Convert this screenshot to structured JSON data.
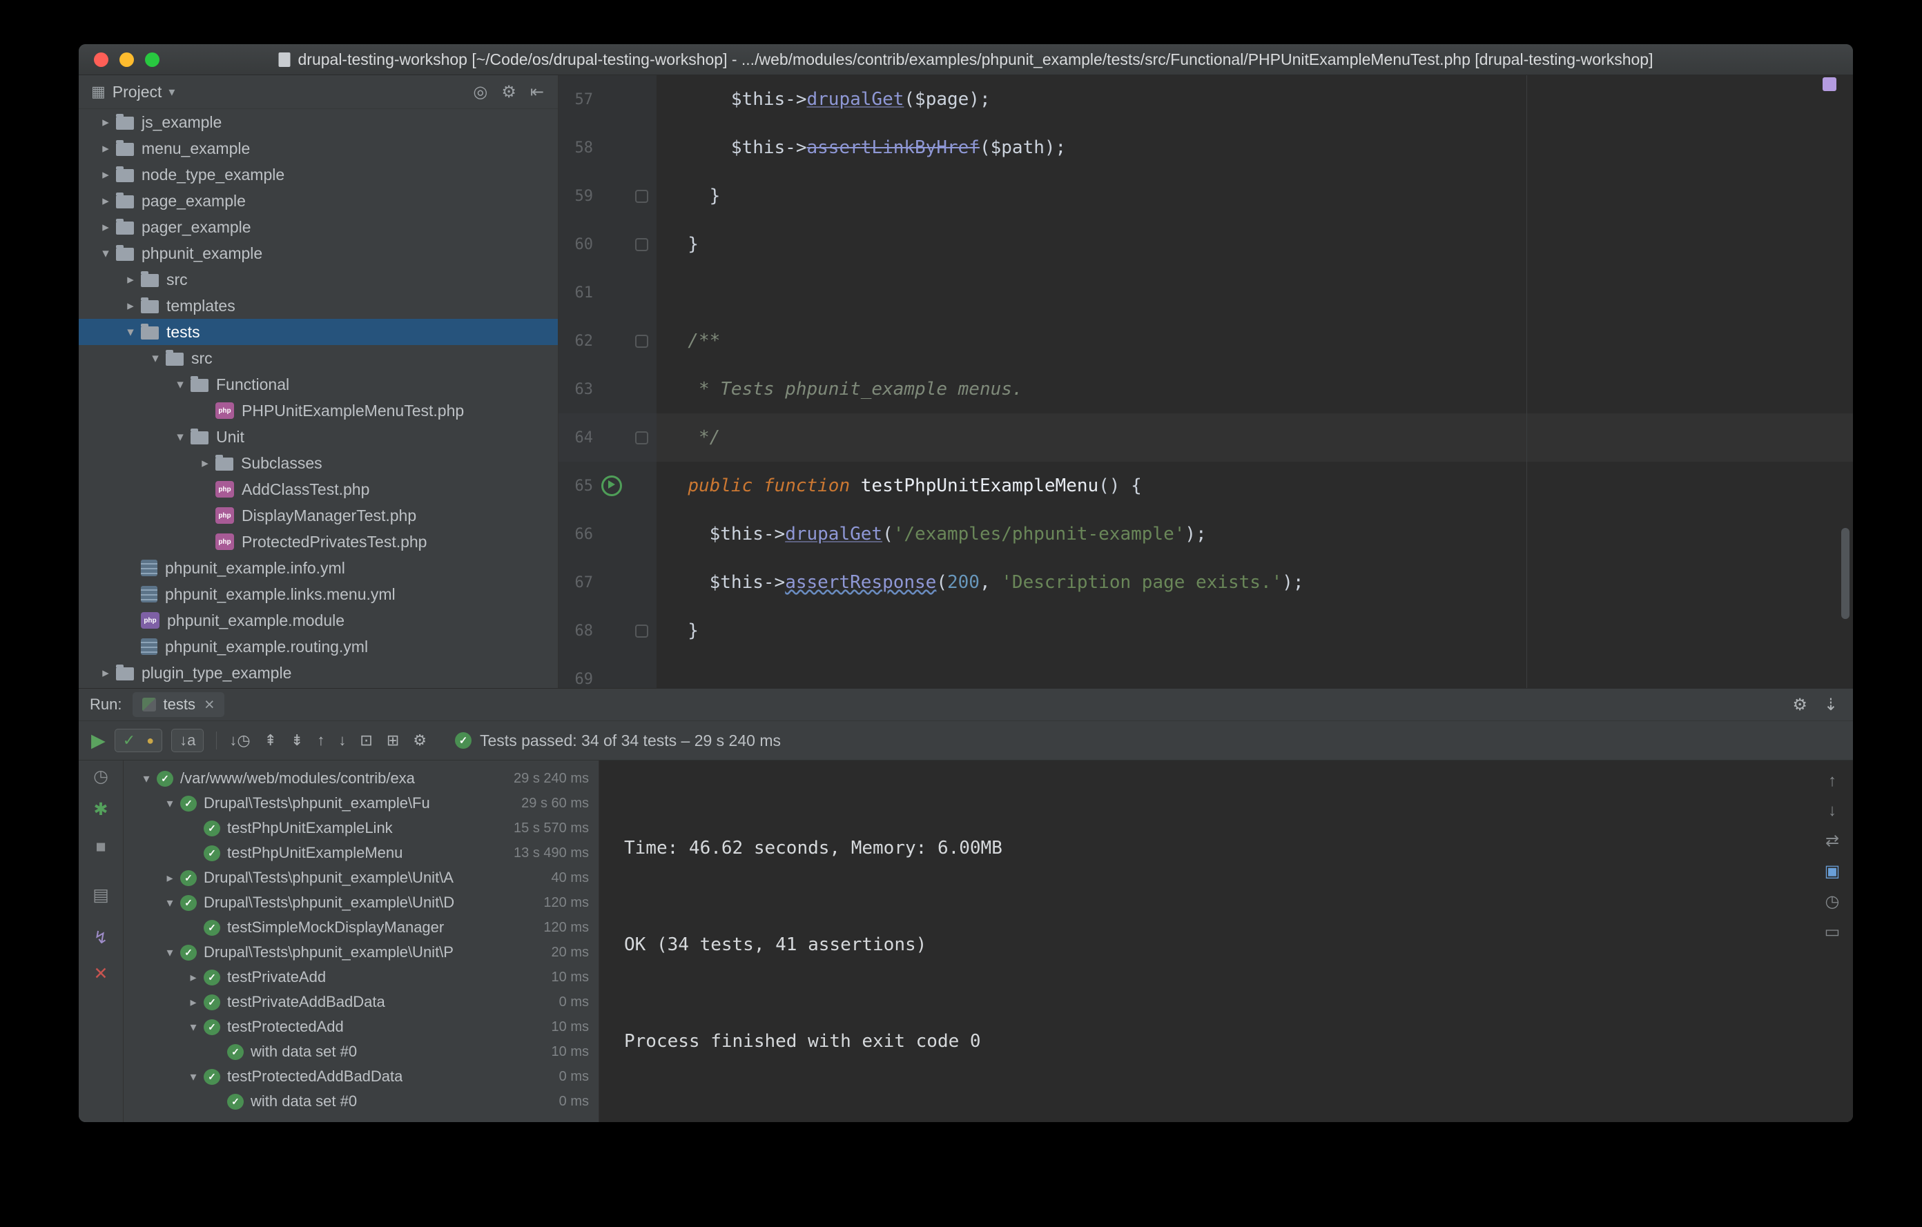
{
  "icons": {
    "expanded": "▾",
    "collapsed": "▸",
    "check": "✓",
    "close": "×",
    "php_badge": "php",
    "chevron": "▾",
    "project_tool": "▦"
  },
  "window": {
    "title": "drupal-testing-workshop [~/Code/os/drupal-testing-workshop] - .../web/modules/contrib/examples/phpunit_example/tests/src/Functional/PHPUnitExampleMenuTest.php [drupal-testing-workshop]"
  },
  "colors": {
    "selection_blue": "#26537C",
    "accent_green": "#499C54",
    "keyword_orange": "#CC7832",
    "string_green": "#6A8759",
    "number_blue": "#6897BB",
    "method_violet": "#8F98D6"
  },
  "project_panel": {
    "title": "Project",
    "actions": [
      {
        "name": "locate-file-icon",
        "glyph": "◎"
      },
      {
        "name": "settings-icon",
        "glyph": "⚙"
      },
      {
        "name": "hide-panel-icon",
        "glyph": "⇤"
      }
    ],
    "tree": [
      {
        "label": "js_example",
        "indent": 0,
        "arrow": "collapsed",
        "icon": "folder"
      },
      {
        "label": "menu_example",
        "indent": 0,
        "arrow": "collapsed",
        "icon": "folder"
      },
      {
        "label": "node_type_example",
        "indent": 0,
        "arrow": "collapsed",
        "icon": "folder"
      },
      {
        "label": "page_example",
        "indent": 0,
        "arrow": "collapsed",
        "icon": "folder"
      },
      {
        "label": "pager_example",
        "indent": 0,
        "arrow": "collapsed",
        "icon": "folder"
      },
      {
        "label": "phpunit_example",
        "indent": 0,
        "arrow": "expanded",
        "icon": "folder"
      },
      {
        "label": "src",
        "indent": 1,
        "arrow": "collapsed",
        "icon": "folder"
      },
      {
        "label": "templates",
        "indent": 1,
        "arrow": "collapsed",
        "icon": "folder"
      },
      {
        "label": "tests",
        "indent": 1,
        "arrow": "expanded",
        "icon": "folder",
        "selected": true
      },
      {
        "label": "src",
        "indent": 2,
        "arrow": "expanded",
        "icon": "folder"
      },
      {
        "label": "Functional",
        "indent": 3,
        "arrow": "expanded",
        "icon": "folder"
      },
      {
        "label": "PHPUnitExampleMenuTest.php",
        "indent": 4,
        "arrow": null,
        "icon": "php"
      },
      {
        "label": "Unit",
        "indent": 3,
        "arrow": "expanded",
        "icon": "folder"
      },
      {
        "label": "Subclasses",
        "indent": 4,
        "arrow": "collapsed",
        "icon": "folder"
      },
      {
        "label": "AddClassTest.php",
        "indent": 4,
        "arrow": null,
        "icon": "php"
      },
      {
        "label": "DisplayManagerTest.php",
        "indent": 4,
        "arrow": null,
        "icon": "php"
      },
      {
        "label": "ProtectedPrivatesTest.php",
        "indent": 4,
        "arrow": null,
        "icon": "php"
      },
      {
        "label": "phpunit_example.info.yml",
        "indent": 1,
        "arrow": null,
        "icon": "yml"
      },
      {
        "label": "phpunit_example.links.menu.yml",
        "indent": 1,
        "arrow": null,
        "icon": "yml"
      },
      {
        "label": "phpunit_example.module",
        "indent": 1,
        "arrow": null,
        "icon": "module"
      },
      {
        "label": "phpunit_example.routing.yml",
        "indent": 1,
        "arrow": null,
        "icon": "yml"
      },
      {
        "label": "plugin_type_example",
        "indent": 0,
        "arrow": "collapsed",
        "icon": "folder"
      }
    ]
  },
  "editor": {
    "lines": [
      {
        "num": "57",
        "gutter": "",
        "segments": [
          {
            "t": "      $this->",
            "s": "p"
          },
          {
            "t": "drupalGet",
            "s": "m"
          },
          {
            "t": "($page);",
            "s": "p"
          }
        ]
      },
      {
        "num": "58",
        "gutter": "",
        "segments": [
          {
            "t": "      $this->",
            "s": "p"
          },
          {
            "t": "assertLinkByHref",
            "s": "ms"
          },
          {
            "t": "($path);",
            "s": "p"
          }
        ]
      },
      {
        "num": "59",
        "gutter": "fold",
        "segments": [
          {
            "t": "    }",
            "s": "p"
          }
        ]
      },
      {
        "num": "60",
        "gutter": "fold",
        "segments": [
          {
            "t": "  }",
            "s": "p"
          }
        ]
      },
      {
        "num": "61",
        "gutter": "",
        "segments": []
      },
      {
        "num": "62",
        "gutter": "fold",
        "segments": [
          {
            "t": "  /**",
            "s": "c"
          }
        ]
      },
      {
        "num": "63",
        "gutter": "",
        "segments": [
          {
            "t": "   * Tests phpunit_example menus.",
            "s": "c"
          }
        ]
      },
      {
        "num": "64",
        "gutter": "fold",
        "caret": true,
        "segments": [
          {
            "t": "   */",
            "s": "c"
          }
        ]
      },
      {
        "num": "65",
        "gutter": "run",
        "segments": [
          {
            "t": "  ",
            "s": "p"
          },
          {
            "t": "public function",
            "s": "k"
          },
          {
            "t": " ",
            "s": "p"
          },
          {
            "t": "testPhpUnitExampleMenu",
            "s": "f"
          },
          {
            "t": "() {",
            "s": "p"
          }
        ]
      },
      {
        "num": "66",
        "gutter": "",
        "segments": [
          {
            "t": "    $this->",
            "s": "p"
          },
          {
            "t": "drupalGet",
            "s": "m"
          },
          {
            "t": "(",
            "s": "p"
          },
          {
            "t": "'/examples/phpunit-example'",
            "s": "str"
          },
          {
            "t": ");",
            "s": "p"
          }
        ]
      },
      {
        "num": "67",
        "gutter": "",
        "segments": [
          {
            "t": "    $this->",
            "s": "p"
          },
          {
            "t": "assertResponse",
            "s": "mw"
          },
          {
            "t": "(",
            "s": "p"
          },
          {
            "t": "200",
            "s": "n"
          },
          {
            "t": ", ",
            "s": "p"
          },
          {
            "t": "'Description page exists.'",
            "s": "str"
          },
          {
            "t": ");",
            "s": "p"
          }
        ]
      },
      {
        "num": "68",
        "gutter": "fold",
        "segments": [
          {
            "t": "  }",
            "s": "p"
          }
        ]
      },
      {
        "num": "69",
        "gutter": "",
        "segments": []
      }
    ]
  },
  "run_panel": {
    "label": "Run:",
    "tab": "tests",
    "tab_actions": [
      {
        "name": "settings-icon",
        "glyph": "⚙"
      },
      {
        "name": "hide-panel-icon",
        "glyph": "⇣"
      }
    ],
    "toolbar": {
      "rerun": {
        "name": "rerun-tests-icon",
        "glyph": "▶"
      },
      "filters": [
        {
          "name": "show-passed-icon",
          "glyph": "✓",
          "color": "green"
        },
        {
          "name": "show-ignored-icon",
          "glyph": "●",
          "color": "yellow"
        }
      ],
      "sort": [
        {
          "name": "sort-alphabetically-icon",
          "glyph": "↓a"
        }
      ],
      "icons": [
        {
          "name": "sort-by-duration-icon",
          "glyph": "↓◷"
        },
        {
          "name": "collapse-all-icon",
          "glyph": "⇞"
        },
        {
          "name": "expand-all-icon",
          "glyph": "⇟"
        },
        {
          "name": "previous-failed-test-icon",
          "glyph": "↑"
        },
        {
          "name": "next-failed-test-icon",
          "glyph": "↓"
        },
        {
          "name": "import-test-results-icon",
          "glyph": "⊡"
        },
        {
          "name": "export-test-results-icon",
          "glyph": "⊞"
        },
        {
          "name": "test-settings-icon",
          "glyph": "⚙"
        }
      ]
    },
    "status": {
      "text": "Tests passed: 34 of 34 tests – 29 s 240 ms"
    },
    "left_strip": [
      {
        "name": "test-history-icon",
        "glyph": "◷"
      },
      {
        "name": "rerun-failed-tests-icon",
        "glyph": "✱",
        "color": "green"
      },
      {
        "name": "stop-icon",
        "glyph": "■"
      },
      {
        "name": "console-view-icon",
        "glyph": "▤"
      },
      {
        "name": "plug-icon",
        "glyph": "↯",
        "color": "violet"
      },
      {
        "name": "close-icon",
        "glyph": "✕",
        "color": "red"
      }
    ],
    "tree": [
      {
        "label": "/var/www/web/modules/contrib/exa",
        "duration": "29 s 240 ms",
        "indent": 0,
        "arrow": "expanded"
      },
      {
        "label": "Drupal\\Tests\\phpunit_example\\Fu",
        "duration": "29 s 60 ms",
        "indent": 1,
        "arrow": "expanded"
      },
      {
        "label": "testPhpUnitExampleLink",
        "duration": "15 s 570 ms",
        "indent": 2,
        "arrow": null
      },
      {
        "label": "testPhpUnitExampleMenu",
        "duration": "13 s 490 ms",
        "indent": 2,
        "arrow": null
      },
      {
        "label": "Drupal\\Tests\\phpunit_example\\Unit\\A",
        "duration": "40 ms",
        "indent": 1,
        "arrow": "collapsed"
      },
      {
        "label": "Drupal\\Tests\\phpunit_example\\Unit\\D",
        "duration": "120 ms",
        "indent": 1,
        "arrow": "expanded"
      },
      {
        "label": "testSimpleMockDisplayManager",
        "duration": "120 ms",
        "indent": 2,
        "arrow": null
      },
      {
        "label": "Drupal\\Tests\\phpunit_example\\Unit\\P",
        "duration": "20 ms",
        "indent": 1,
        "arrow": "expanded"
      },
      {
        "label": "testPrivateAdd",
        "duration": "10 ms",
        "indent": 2,
        "arrow": "collapsed"
      },
      {
        "label": "testPrivateAddBadData",
        "duration": "0 ms",
        "indent": 2,
        "arrow": "collapsed"
      },
      {
        "label": "testProtectedAdd",
        "duration": "10 ms",
        "indent": 2,
        "arrow": "expanded"
      },
      {
        "label": "with data set #0",
        "duration": "10 ms",
        "indent": 3,
        "arrow": null
      },
      {
        "label": "testProtectedAddBadData",
        "duration": "0 ms",
        "indent": 2,
        "arrow": "expanded"
      },
      {
        "label": "with data set #0",
        "duration": "0 ms",
        "indent": 3,
        "arrow": null
      }
    ],
    "console": {
      "lines": [
        "Time: 46.62 seconds, Memory: 6.00MB",
        "",
        "OK (34 tests, 41 assertions)",
        "",
        "Process finished with exit code 0"
      ],
      "actions": [
        {
          "name": "scroll-to-top-icon",
          "glyph": "↑"
        },
        {
          "name": "scroll-to-bottom-icon",
          "glyph": "↓"
        },
        {
          "name": "soft-wrap-icon",
          "glyph": "⇄"
        },
        {
          "name": "open-results-in-editor-icon",
          "glyph": "▣",
          "color": "blue"
        },
        {
          "name": "console-history-icon",
          "glyph": "◷"
        },
        {
          "name": "clear-all-icon",
          "glyph": "▭"
        }
      ]
    }
  }
}
